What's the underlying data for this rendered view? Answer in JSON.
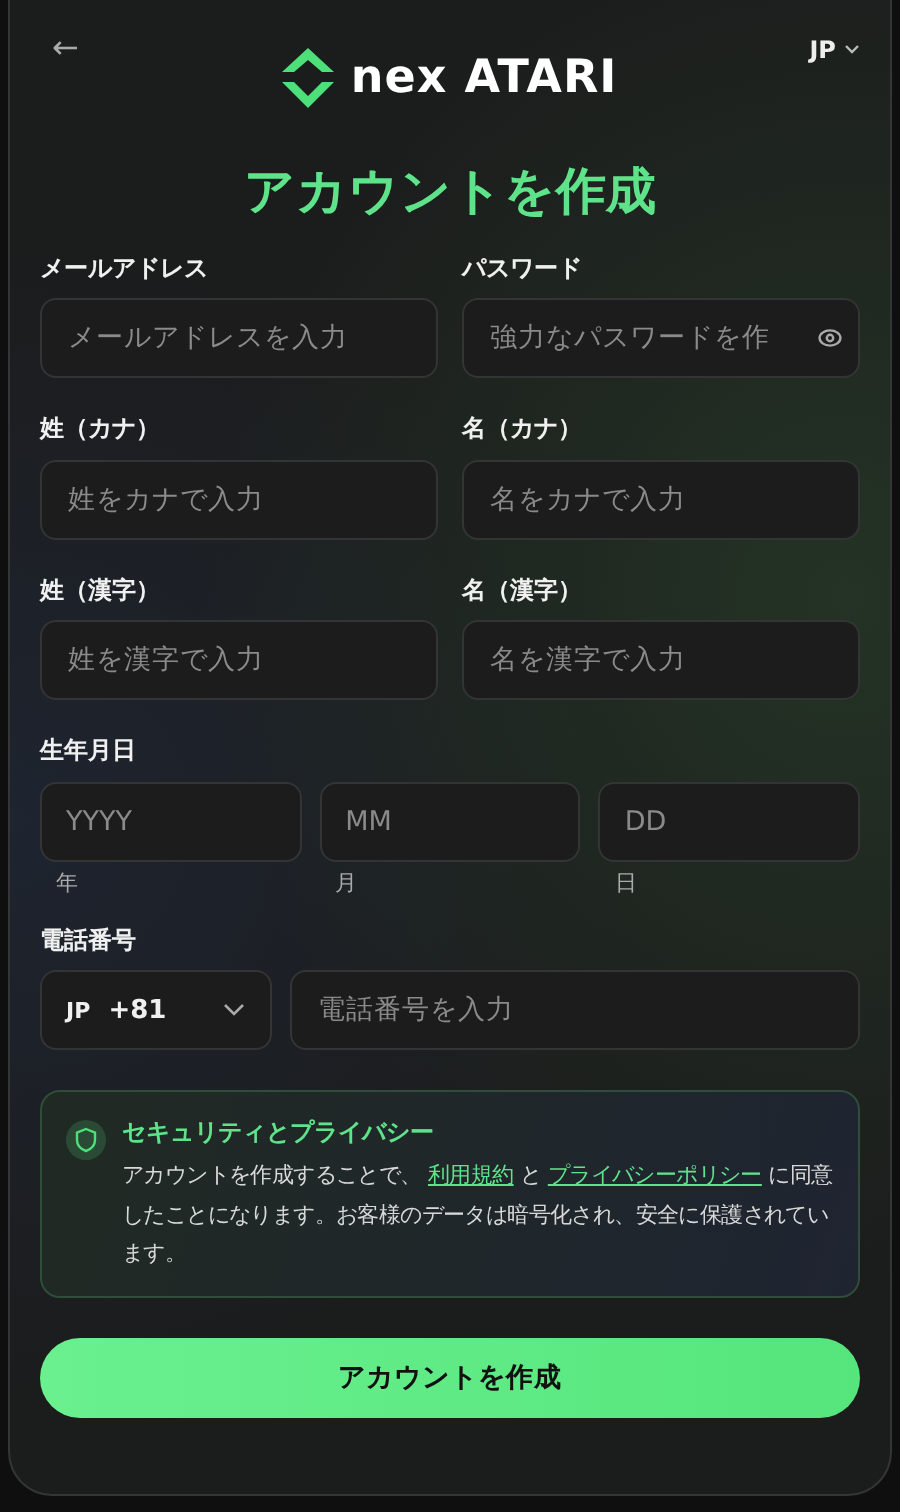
{
  "header": {
    "back": "←",
    "language": "JP",
    "logo": "nex ATARI"
  },
  "title": "アカウントを作成",
  "field_rows": [
    {
      "fields": [
        {
          "label": "メールアドレス",
          "placeholder": "メールアドレスを入力",
          "kind": "text"
        },
        {
          "label": "パスワード",
          "placeholder": "強力なパスワードを作",
          "kind": "password"
        }
      ]
    },
    {
      "fields": [
        {
          "label": "姓（カナ）",
          "placeholder": "姓をカナで入力",
          "kind": "text"
        },
        {
          "label": "名（カナ）",
          "placeholder": "名をカナで入力",
          "kind": "text"
        }
      ]
    },
    {
      "fields": [
        {
          "label": "姓（漢字）",
          "placeholder": "姓を漢字で入力",
          "kind": "text"
        },
        {
          "label": "名（漢字）",
          "placeholder": "名を漢字で入力",
          "kind": "text"
        }
      ]
    }
  ],
  "birthdate": {
    "label": "生年月日",
    "parts": [
      {
        "placeholder": "YYYY",
        "caption": "年"
      },
      {
        "placeholder": "MM",
        "caption": "月"
      },
      {
        "placeholder": "DD",
        "caption": "日"
      }
    ]
  },
  "phone": {
    "label": "電話番号",
    "country": "JP",
    "code": "+81",
    "placeholder": "電話番号を入力"
  },
  "notice": {
    "title": "セキュリティとプライバシー",
    "segments": [
      {
        "kind": "text",
        "text": "アカウントを作成することで、 "
      },
      {
        "kind": "link",
        "text": "利用規約"
      },
      {
        "kind": "text",
        "text": " と "
      },
      {
        "kind": "link",
        "text": "プライバシーポリシー"
      },
      {
        "kind": "text",
        "text": " に同意したことになります。お客様のデータは暗号化され、安全に保護されています。"
      }
    ]
  },
  "submit": "アカウントを作成"
}
